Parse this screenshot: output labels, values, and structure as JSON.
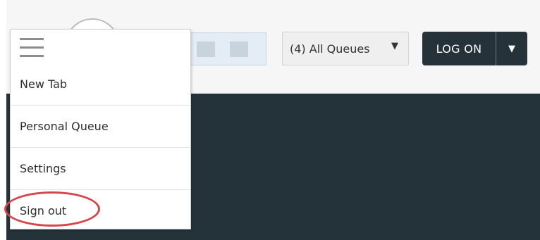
{
  "toolbar": {
    "queue_select_label": "(4) All Queues",
    "logon_label": "LOG ON"
  },
  "menu": {
    "items": [
      {
        "label": "New Tab"
      },
      {
        "label": "Personal Queue"
      },
      {
        "label": "Settings"
      },
      {
        "label": "Sign out"
      }
    ]
  },
  "icons": {
    "menu": "hamburger-icon",
    "queue_caret": "caret-down-icon",
    "logon_caret": "caret-down-icon"
  },
  "colors": {
    "dark_panel": "#24333a",
    "logon_button": "#26323a",
    "highlight": "#d6454a"
  }
}
